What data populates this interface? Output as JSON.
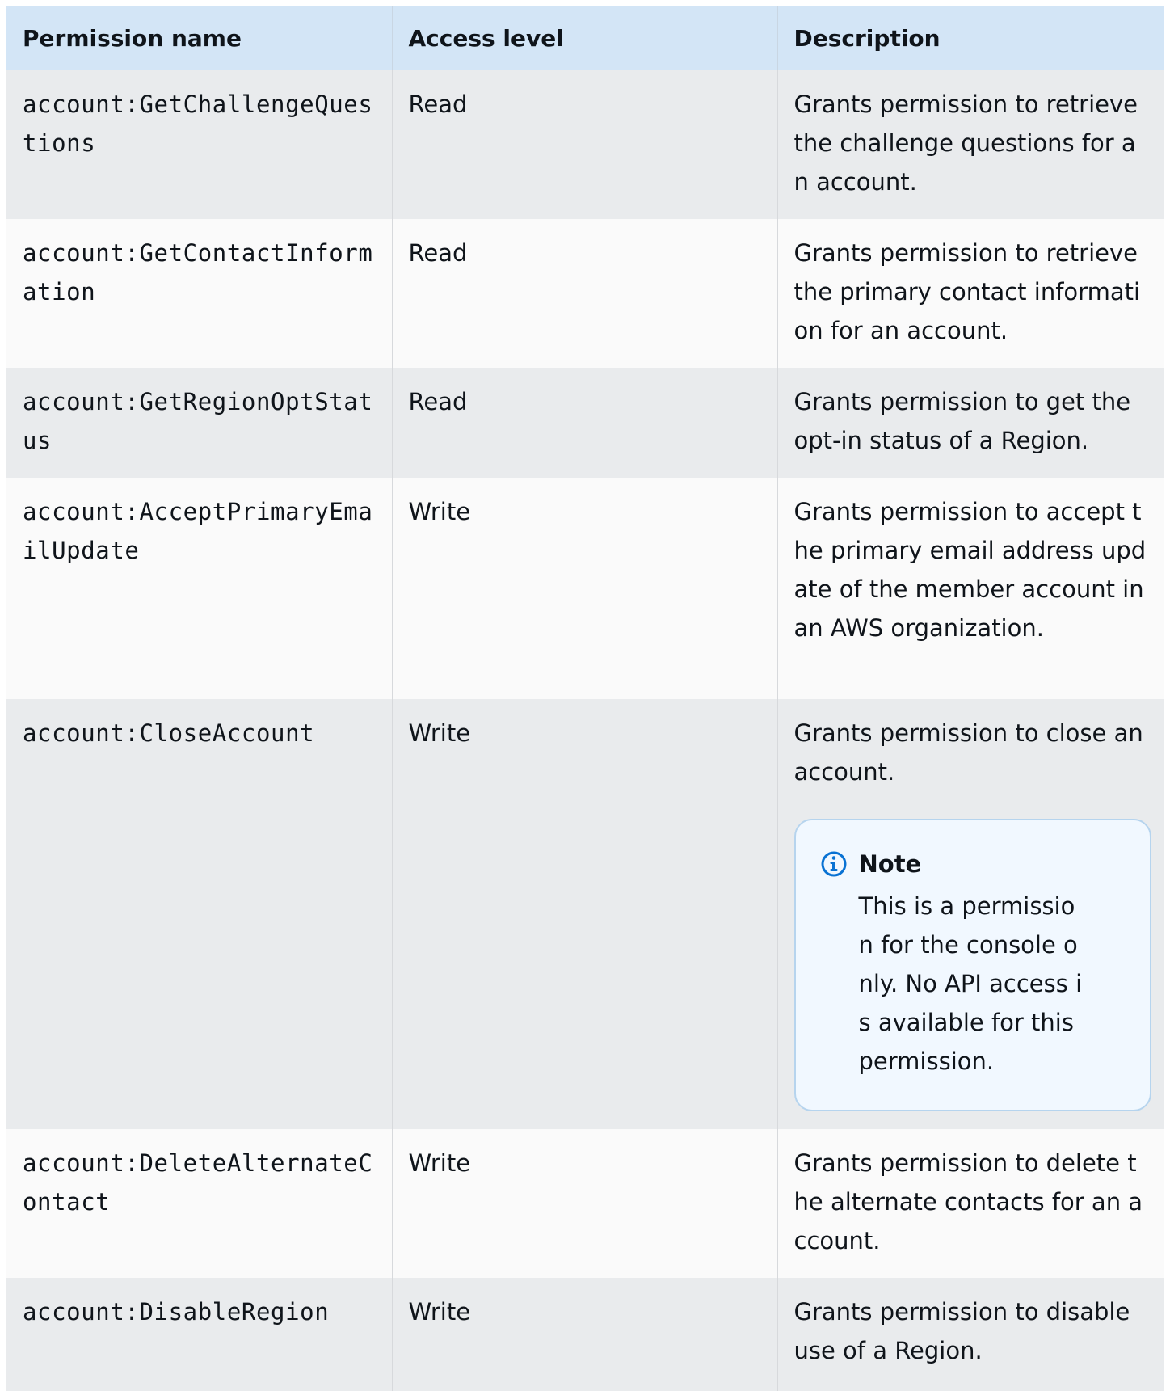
{
  "table": {
    "headers": {
      "permission_name": "Permission name",
      "access_level": "Access level",
      "description": "Description"
    },
    "rows": [
      {
        "permission": "account:GetChallengeQuestions",
        "access_level": "Read",
        "description": "Grants permission to retrieve the challenge questions for an account."
      },
      {
        "permission": "account:GetContactInformation",
        "access_level": "Read",
        "description": "Grants permission to retrieve the primary contact information for an account."
      },
      {
        "permission": "account:GetRegionOptStatus",
        "access_level": "Read",
        "description": "Grants permission to get the opt-in status of a Region."
      },
      {
        "permission": "account:AcceptPrimaryEmailUpdate",
        "access_level": "Write",
        "description": "Grants permission to accept the primary email address update of the member account in an AWS organization."
      },
      {
        "permission": "account:CloseAccount",
        "access_level": "Write",
        "description": "Grants permission to close an account.",
        "note": {
          "title": "Note",
          "text": "This is a permission for the console only. No API access is available for this permission."
        }
      },
      {
        "permission": "account:DeleteAlternateContact",
        "access_level": "Write",
        "description": "Grants permission to delete the alternate contacts for an account."
      },
      {
        "permission": "account:DisableRegion",
        "access_level": "Write",
        "description": "Grants permission to disable use of a Region."
      }
    ]
  },
  "colors": {
    "header_bg": "#d3e5f6",
    "row_odd_bg": "#e9ebed",
    "row_even_bg": "#fafafa",
    "note_bg": "#f1f8ff",
    "note_border": "#b6d4ee",
    "info_icon": "#0972d3"
  },
  "icons": {
    "note": "info-icon"
  }
}
